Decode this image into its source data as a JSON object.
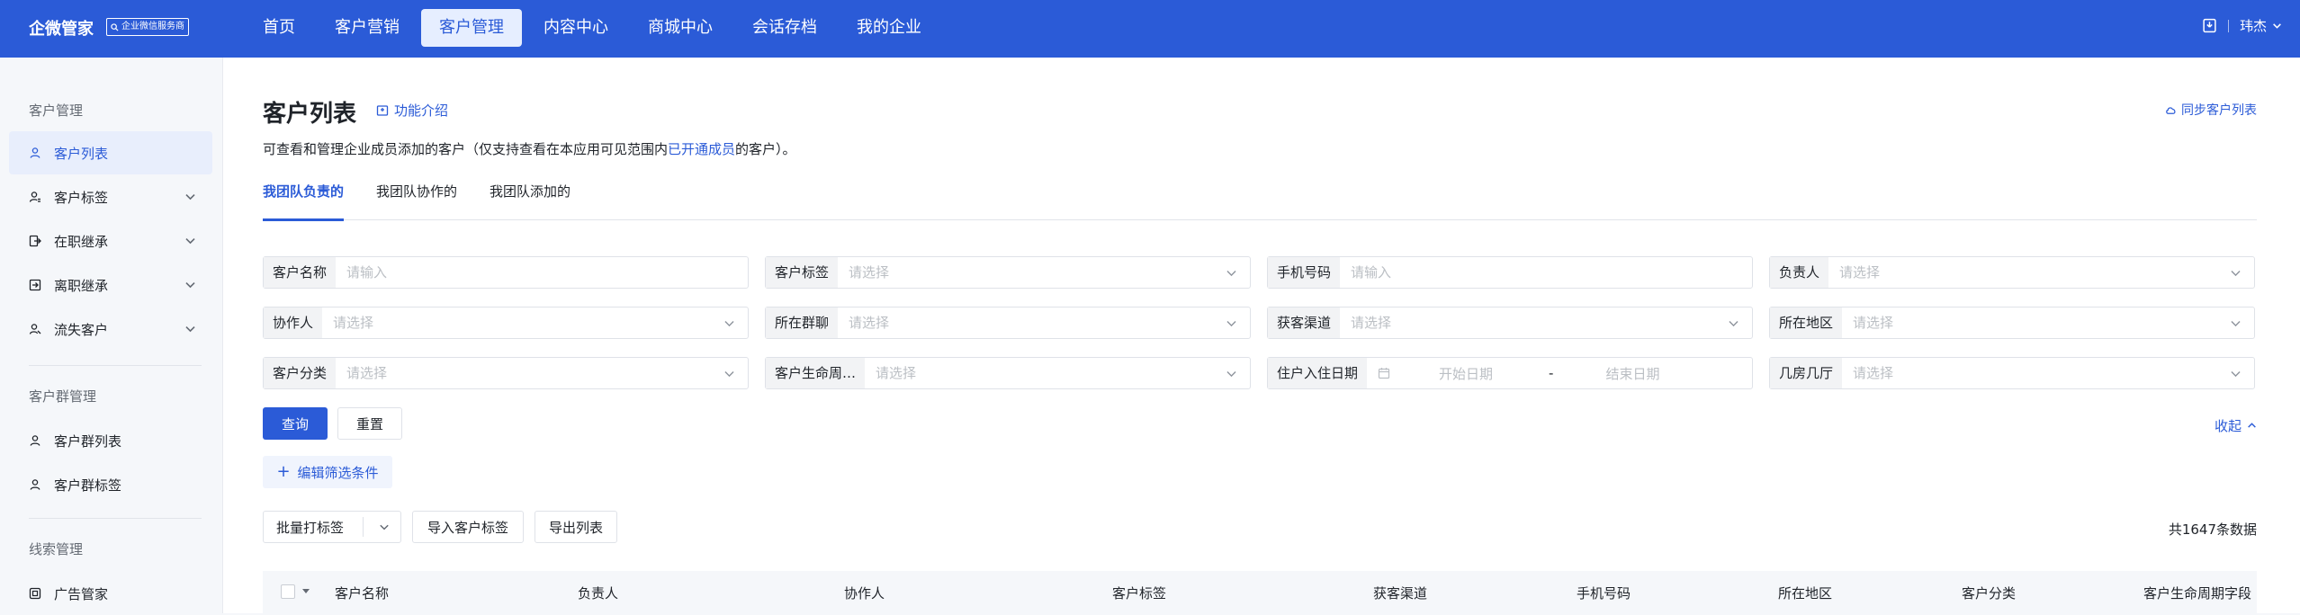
{
  "app": {
    "brand": "企微管家",
    "badge": "企业微信服务商"
  },
  "nav": [
    {
      "label": "首页"
    },
    {
      "label": "客户营销"
    },
    {
      "label": "客户管理"
    },
    {
      "label": "内容中心"
    },
    {
      "label": "商城中心"
    },
    {
      "label": "会话存档"
    },
    {
      "label": "我的企业"
    }
  ],
  "user": {
    "name": "玮杰"
  },
  "sidebar": {
    "groups": [
      {
        "title": "客户管理",
        "items": [
          {
            "label": "客户列表",
            "icon": "user-icon"
          },
          {
            "label": "客户标签",
            "icon": "user-tag-icon"
          },
          {
            "label": "在职继承",
            "icon": "transfer-icon"
          },
          {
            "label": "离职继承",
            "icon": "resign-icon"
          },
          {
            "label": "流失客户",
            "icon": "user-lost-icon"
          }
        ]
      },
      {
        "title": "客户群管理",
        "items": [
          {
            "label": "客户群列表",
            "icon": "group-icon"
          },
          {
            "label": "客户群标签",
            "icon": "group-tag-icon"
          }
        ]
      },
      {
        "title": "线索管理",
        "items": [
          {
            "label": "广告管家",
            "icon": "ad-icon"
          }
        ]
      }
    ]
  },
  "page": {
    "title": "客户列表",
    "intro_link": "功能介绍",
    "sync_link": "同步客户列表",
    "desc_before": "可查看和管理企业成员添加的客户（仅支持查看在本应用可见范围内",
    "desc_link": "已开通成员",
    "desc_after": "的客户）。"
  },
  "tabs": [
    {
      "label": "我团队负责的"
    },
    {
      "label": "我团队协作的"
    },
    {
      "label": "我团队添加的"
    }
  ],
  "filters": {
    "customer_name": {
      "label": "客户名称",
      "placeholder": "请输入"
    },
    "customer_tag": {
      "label": "客户标签",
      "placeholder": "请选择"
    },
    "phone": {
      "label": "手机号码",
      "placeholder": "请输入"
    },
    "owner": {
      "label": "负责人",
      "placeholder": "请选择"
    },
    "collaborator": {
      "label": "协作人",
      "placeholder": "请选择"
    },
    "group": {
      "label": "所在群聊",
      "placeholder": "请选择"
    },
    "channel": {
      "label": "获客渠道",
      "placeholder": "请选择"
    },
    "region": {
      "label": "所在地区",
      "placeholder": "请选择"
    },
    "category": {
      "label": "客户分类",
      "placeholder": "请选择"
    },
    "lifecycle": {
      "label": "客户生命周…",
      "placeholder": "请选择"
    },
    "checkin_date": {
      "label": "住户入住日期",
      "start": "开始日期",
      "sep": "-",
      "end": "结束日期"
    },
    "rooms": {
      "label": "几房几厅",
      "placeholder": "请选择"
    }
  },
  "actions": {
    "query": "查询",
    "reset": "重置",
    "collapse": "收起",
    "edit_filters": "编辑筛选条件",
    "batch_tag": "批量打标签",
    "import_tags": "导入客户标签",
    "export_list": "导出列表",
    "total": "共1647条数据"
  },
  "table": {
    "columns": [
      "客户名称",
      "负责人",
      "协作人",
      "客户标签",
      "获客渠道",
      "手机号码",
      "所在地区",
      "客户分类",
      "客户生命周期字段"
    ]
  },
  "colors": {
    "primary": "#2b5bd7",
    "topbar": "#2b5bd7",
    "sidebar_bg": "#f5f7fa"
  }
}
